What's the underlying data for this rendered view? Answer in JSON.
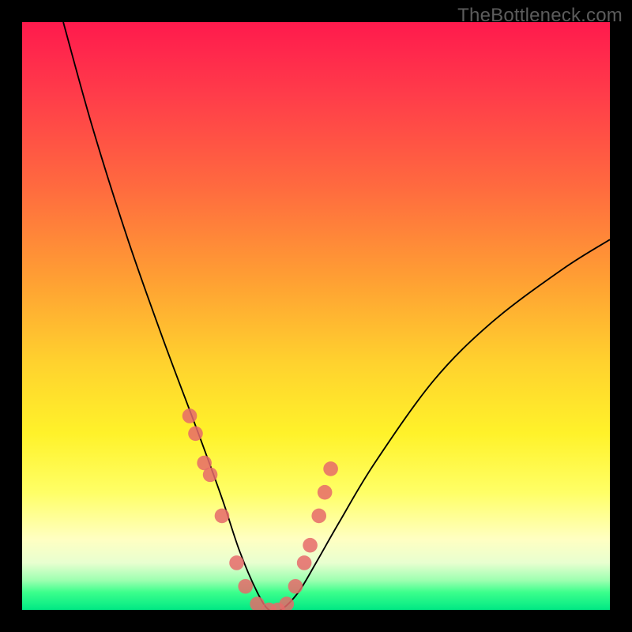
{
  "watermark": "TheBottleneck.com",
  "chart_data": {
    "type": "line",
    "title": "",
    "xlabel": "",
    "ylabel": "",
    "xlim": [
      0,
      100
    ],
    "ylim": [
      0,
      100
    ],
    "note": "Bottleneck V-curve; values are approximate pixel-read percentages. Minimum (best match) is around x≈42.",
    "series": [
      {
        "name": "bottleneck-curve",
        "x": [
          7,
          12,
          18,
          24,
          30,
          34,
          37,
          40,
          42,
          44,
          47,
          50,
          54,
          60,
          70,
          80,
          92,
          100
        ],
        "y": [
          100,
          82,
          63,
          46,
          30,
          19,
          10,
          3,
          0,
          0,
          3,
          8,
          15,
          25,
          39,
          49,
          58,
          63
        ]
      }
    ],
    "markers": {
      "name": "highlighted-points",
      "color": "#e66a6a",
      "x": [
        28.5,
        29.5,
        31,
        32,
        34,
        36.5,
        38,
        40,
        42,
        43.5,
        45,
        46.5,
        48,
        49,
        50.5,
        51.5,
        52.5
      ],
      "y": [
        33,
        30,
        25,
        23,
        16,
        8,
        4,
        1,
        0,
        0,
        1,
        4,
        8,
        11,
        16,
        20,
        24
      ]
    },
    "gradient_bands": [
      {
        "label": "red",
        "approx_y_range": [
          70,
          100
        ]
      },
      {
        "label": "orange",
        "approx_y_range": [
          40,
          70
        ]
      },
      {
        "label": "yellow",
        "approx_y_range": [
          12,
          40
        ]
      },
      {
        "label": "green",
        "approx_y_range": [
          0,
          12
        ]
      }
    ]
  }
}
